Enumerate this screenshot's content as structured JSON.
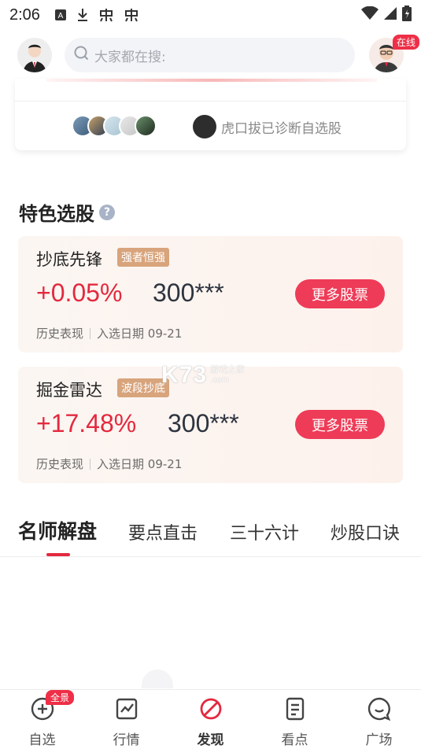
{
  "status_bar": {
    "time": "2:06",
    "icons": [
      "a-box-icon",
      "download-icon",
      "app-icon",
      "app-icon"
    ],
    "right_icons": [
      "wifi-icon",
      "signal-icon",
      "battery-icon"
    ]
  },
  "header": {
    "search_placeholder": "大家都在搜:",
    "online_label": "在线"
  },
  "top_card": {
    "diagnosed_text": "虎口拔已诊断自选股"
  },
  "featured": {
    "title": "特色选股",
    "help_symbol": "?",
    "cards": [
      {
        "name": "抄底先锋",
        "tag": "强者恒强",
        "percent": "+0.05%",
        "code": "300***",
        "button": "更多股票",
        "history_label": "历史表现",
        "date_label": "入选日期 09-21"
      },
      {
        "name": "掘金雷达",
        "tag": "波段抄底",
        "percent": "+17.48%",
        "code": "300***",
        "button": "更多股票",
        "history_label": "历史表现",
        "date_label": "入选日期 09-21"
      }
    ]
  },
  "watermark": {
    "main": "K73",
    "line1": "游戏之家",
    "line2": ".com"
  },
  "tabs": [
    "名师解盘",
    "要点直击",
    "三十六计",
    "炒股口诀"
  ],
  "bottom_nav": {
    "items": [
      {
        "label": "自选",
        "icon": "add-circle-icon"
      },
      {
        "label": "行情",
        "icon": "chart-icon"
      },
      {
        "label": "发现",
        "icon": "discover-icon"
      },
      {
        "label": "看点",
        "icon": "document-icon"
      },
      {
        "label": "广场",
        "icon": "chat-icon"
      }
    ],
    "badge": "全景"
  },
  "colors": {
    "accent_red": "#e3293f",
    "button_red": "#ee3b57",
    "tag_gold": "#d8a47c"
  }
}
